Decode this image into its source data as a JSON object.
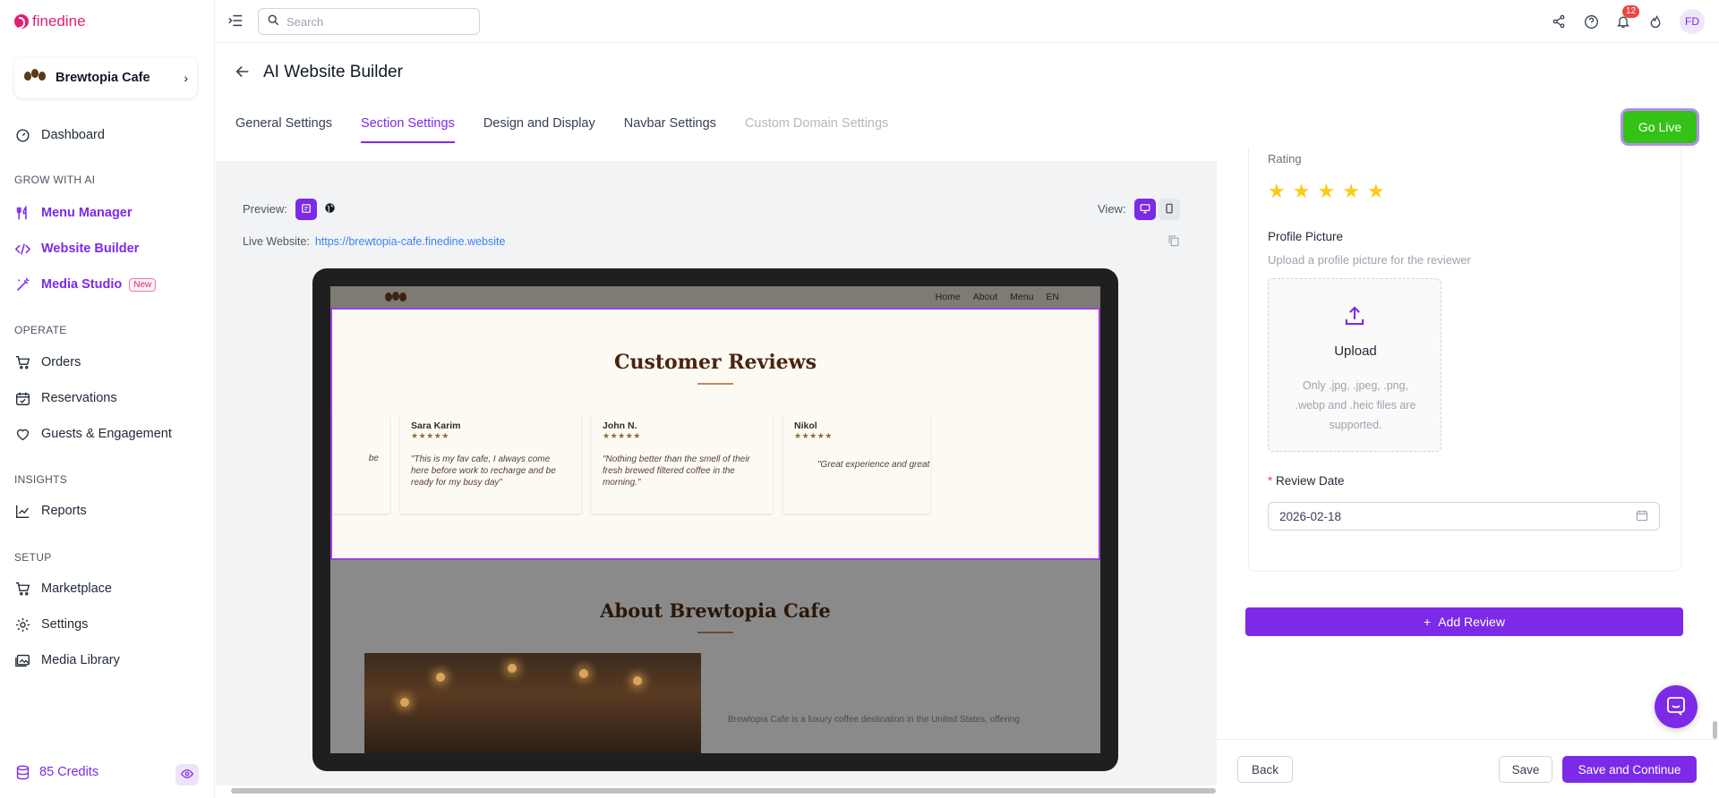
{
  "brand": {
    "name": "finedine",
    "accent": "#7c2ae8",
    "brand_color": "#e11d74",
    "go_live_color": "#34c216"
  },
  "sidebar": {
    "store_name": "Brewtopia Cafe",
    "dashboard": "Dashboard",
    "sections": {
      "grow": "GROW WITH AI",
      "operate": "OPERATE",
      "insights": "INSIGHTS",
      "setup": "SETUP"
    },
    "items": {
      "menu_manager": "Menu Manager",
      "website_builder": "Website Builder",
      "media_studio": "Media Studio",
      "media_studio_badge": "New",
      "orders": "Orders",
      "reservations": "Reservations",
      "guests": "Guests & Engagement",
      "reports": "Reports",
      "marketplace": "Marketplace",
      "settings": "Settings",
      "media_library": "Media Library"
    },
    "credits": "85 Credits"
  },
  "topbar": {
    "search_placeholder": "Search",
    "notification_count": "12",
    "avatar_initials": "FD"
  },
  "page": {
    "title": "AI Website Builder",
    "tabs": [
      {
        "label": "General Settings",
        "state": "normal"
      },
      {
        "label": "Section Settings",
        "state": "active"
      },
      {
        "label": "Design and Display",
        "state": "normal"
      },
      {
        "label": "Navbar Settings",
        "state": "normal"
      },
      {
        "label": "Custom Domain Settings",
        "state": "disabled"
      }
    ],
    "go_live": "Go Live"
  },
  "preview": {
    "preview_label": "Preview:",
    "view_label": "View:",
    "live_label": "Live Website:",
    "live_url": "https://brewtopia-cafe.finedine.website",
    "site": {
      "nav_links": [
        "Home",
        "About",
        "Menu",
        "EN"
      ],
      "reviews_title": "Customer Reviews",
      "reviews": [
        {
          "name": "",
          "quote": "be"
        },
        {
          "name": "Sara Karim",
          "quote": "\"This is my fav cafe, I always come here before work to recharge and be ready for my busy day\""
        },
        {
          "name": "John N.",
          "quote": "\"Nothing better than the smell of their fresh brewed filtered coffee in the morning.\""
        },
        {
          "name": "Nikol",
          "quote": "\"Great experience and great staff"
        }
      ],
      "stars_text": "★★★★★",
      "about_title": "About Brewtopia Cafe",
      "about_text": "Brewtopia Cafe is a luxury coffee destination in the United States, offering"
    }
  },
  "form": {
    "rating_label": "Rating",
    "rating_value": 5,
    "profile_label": "Profile Picture",
    "profile_hint": "Upload a profile picture for the reviewer",
    "upload_title": "Upload",
    "upload_hint": "Only .jpg, .jpeg, .png, .webp and .heic files are supported.",
    "review_date_label": "Review Date",
    "review_date_value": "2026-02-18",
    "add_review": "Add Review"
  },
  "footer": {
    "back": "Back",
    "save": "Save",
    "save_continue": "Save and Continue"
  }
}
